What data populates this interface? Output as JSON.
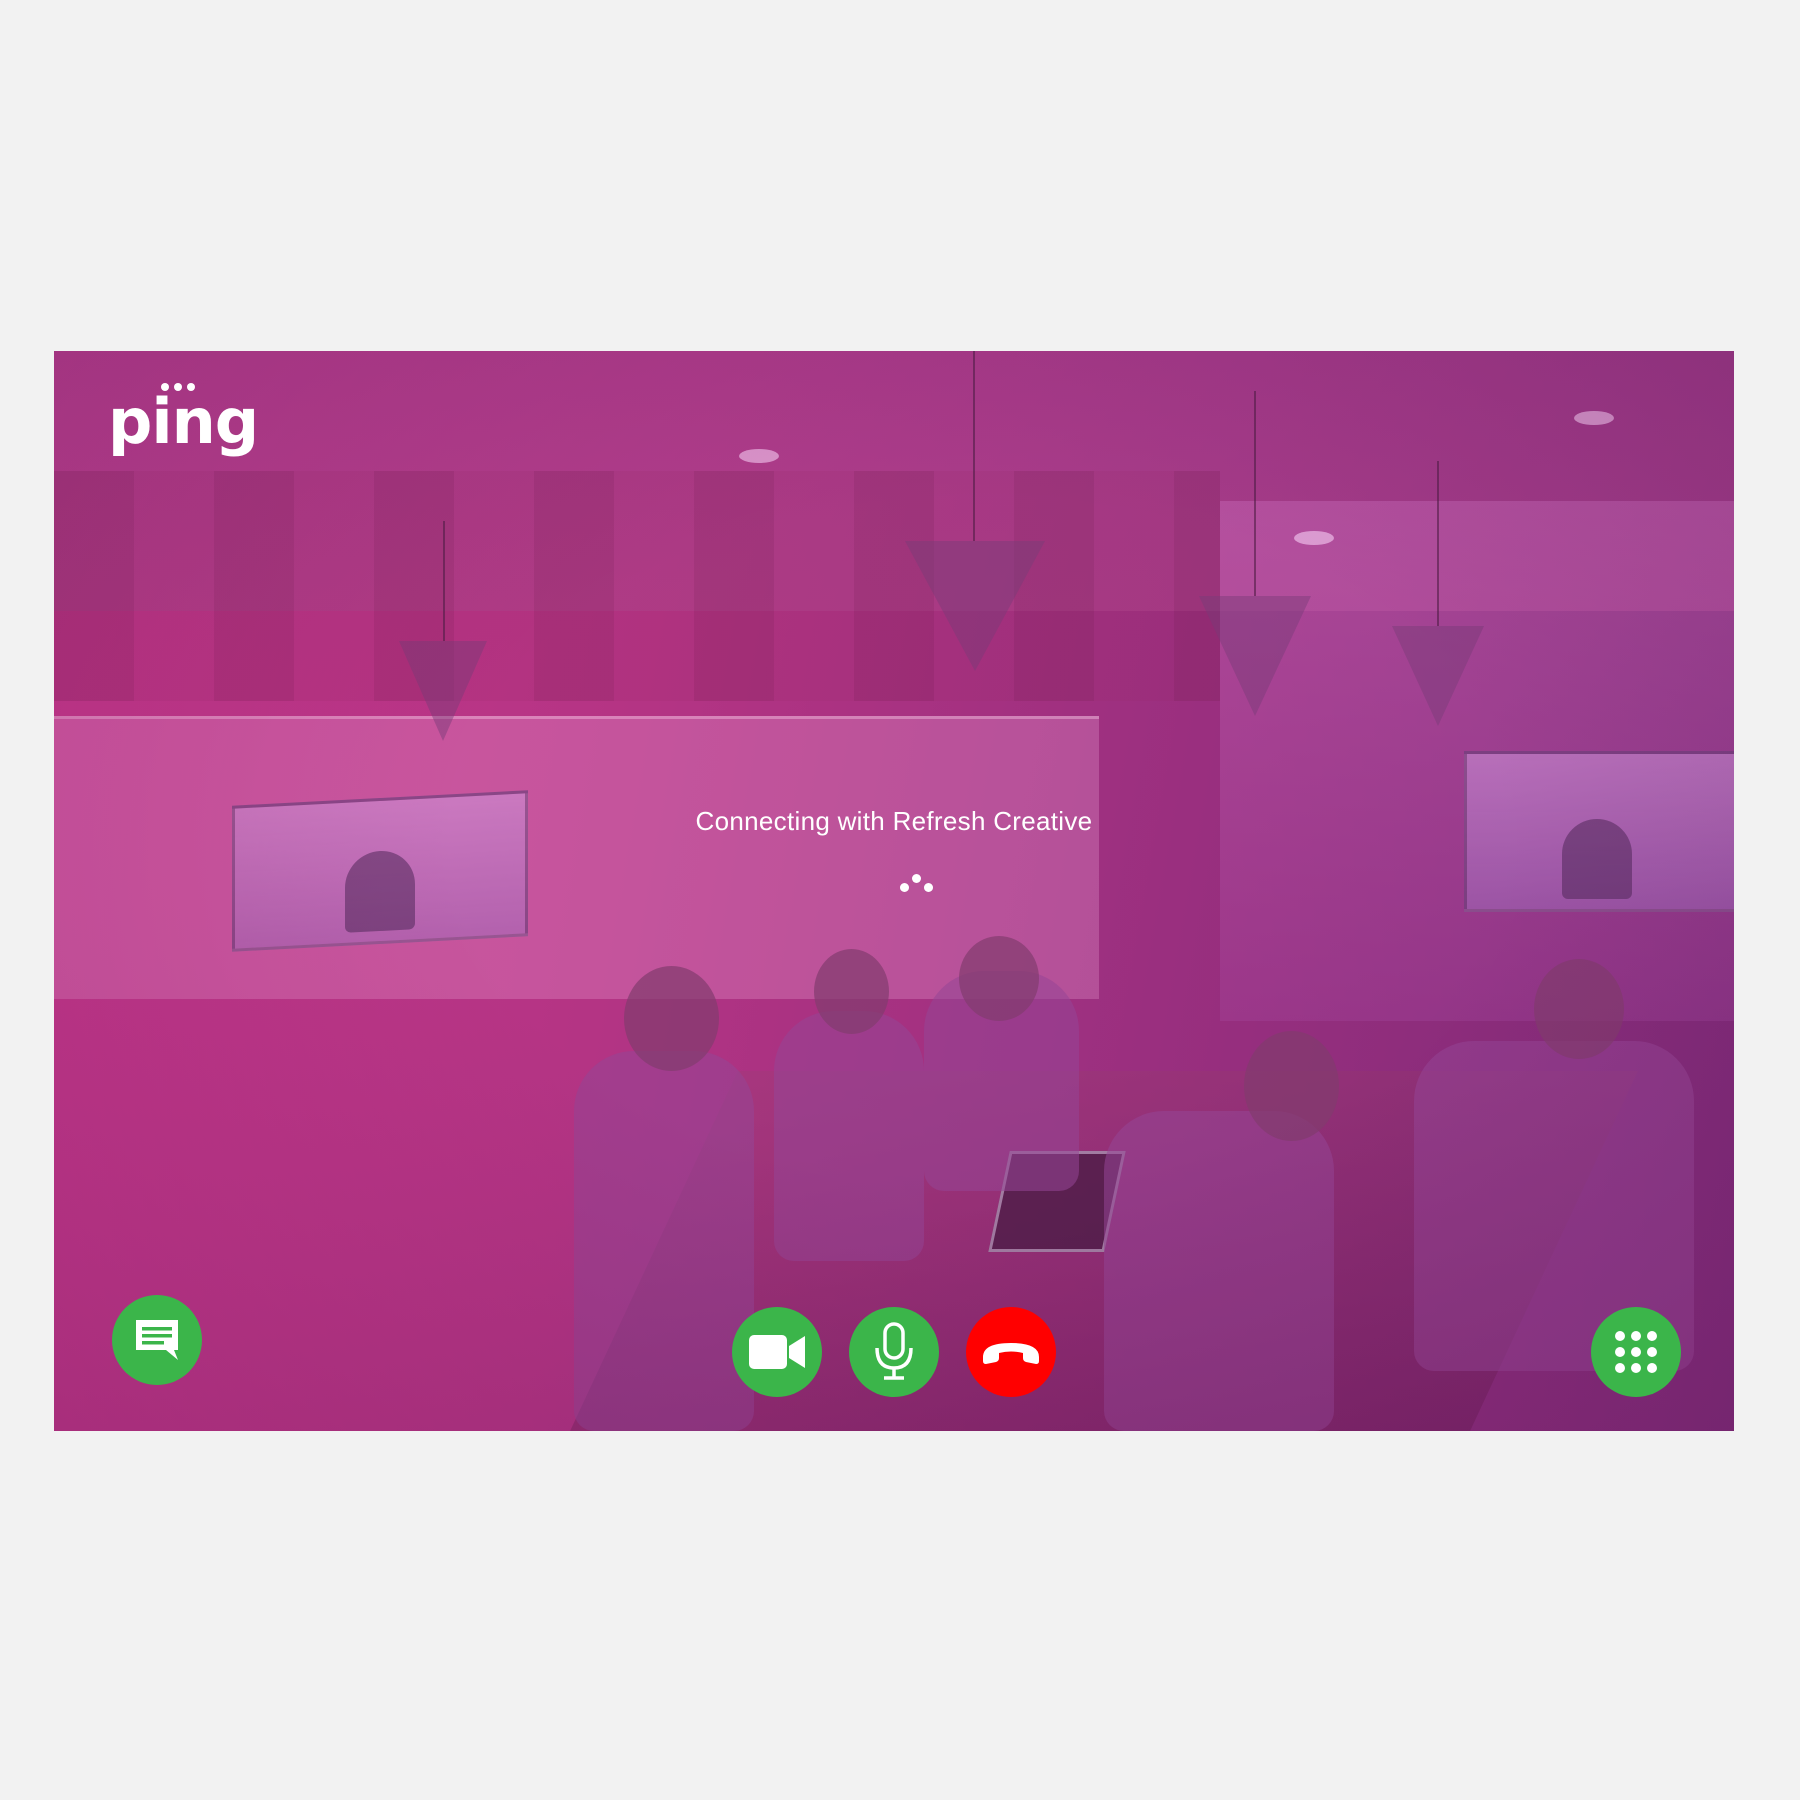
{
  "app": {
    "logo_text": "ping"
  },
  "call": {
    "status_text": "Connecting with Refresh Creative"
  },
  "controls": {
    "chat_icon": "chat-bubble-icon",
    "video_icon": "video-camera-icon",
    "mic_icon": "microphone-icon",
    "end_icon": "hang-up-phone-icon",
    "dialpad_icon": "dialpad-grid-icon"
  },
  "colors": {
    "accent_green": "#3bb54a",
    "end_call_red": "#ff0000",
    "overlay_magenta": "#b43484",
    "page_background": "#f2f2f2"
  }
}
